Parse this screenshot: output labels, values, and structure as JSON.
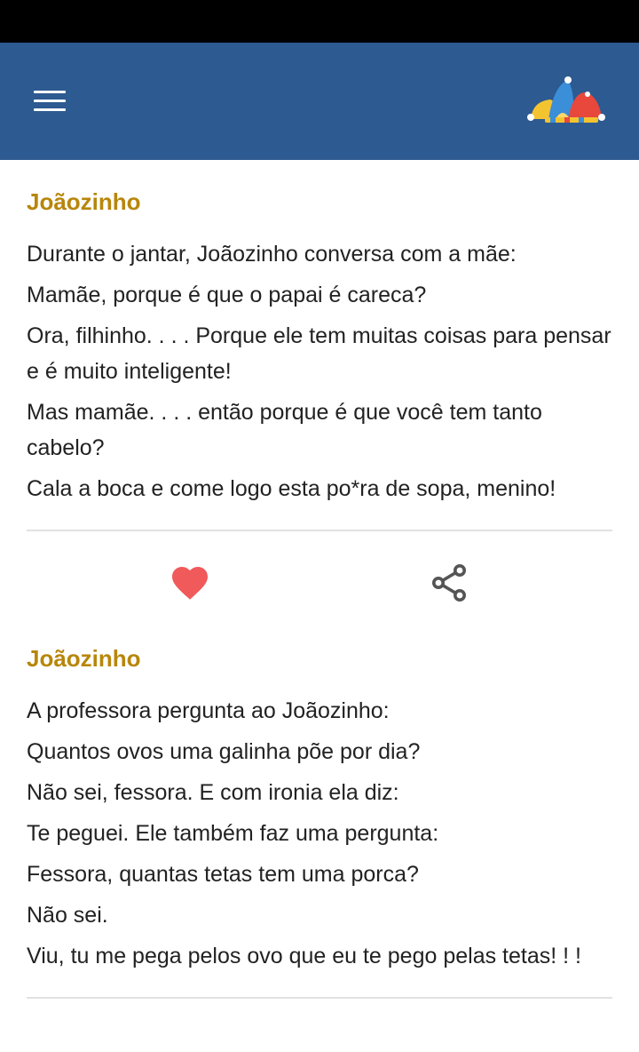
{
  "colors": {
    "app_bar": "#2d5a91",
    "title": "#b8860b",
    "heart": "#f05a5a",
    "share": "#555555"
  },
  "header": {
    "menu_icon": "hamburger-menu-icon",
    "logo_icon": "jester-hat-icon"
  },
  "jokes": [
    {
      "title": "Joãozinho",
      "lines": [
        "Durante o jantar, Joãozinho conversa com a mãe:",
        "Mamãe, porque é que o papai é careca?",
        "Ora, filhinho. . . . Porque ele tem muitas coisas para pensar e é muito inteligente!",
        "Mas mamãe. . . . então porque é que você tem tanto cabelo?",
        "Cala a boca e come logo esta po*ra de sopa, menino!"
      ],
      "actions": {
        "like_icon": "heart-icon",
        "share_icon": "share-icon"
      }
    },
    {
      "title": "Joãozinho",
      "lines": [
        "A professora pergunta ao Joãozinho:",
        "Quantos ovos uma galinha põe por dia?",
        "Não sei, fessora. E com ironia ela diz:",
        "Te peguei. Ele também faz uma pergunta:",
        "Fessora, quantas tetas tem uma porca?",
        "Não sei.",
        "Viu, tu me pega pelos ovo que eu te pego pelas tetas! ! !"
      ]
    }
  ]
}
